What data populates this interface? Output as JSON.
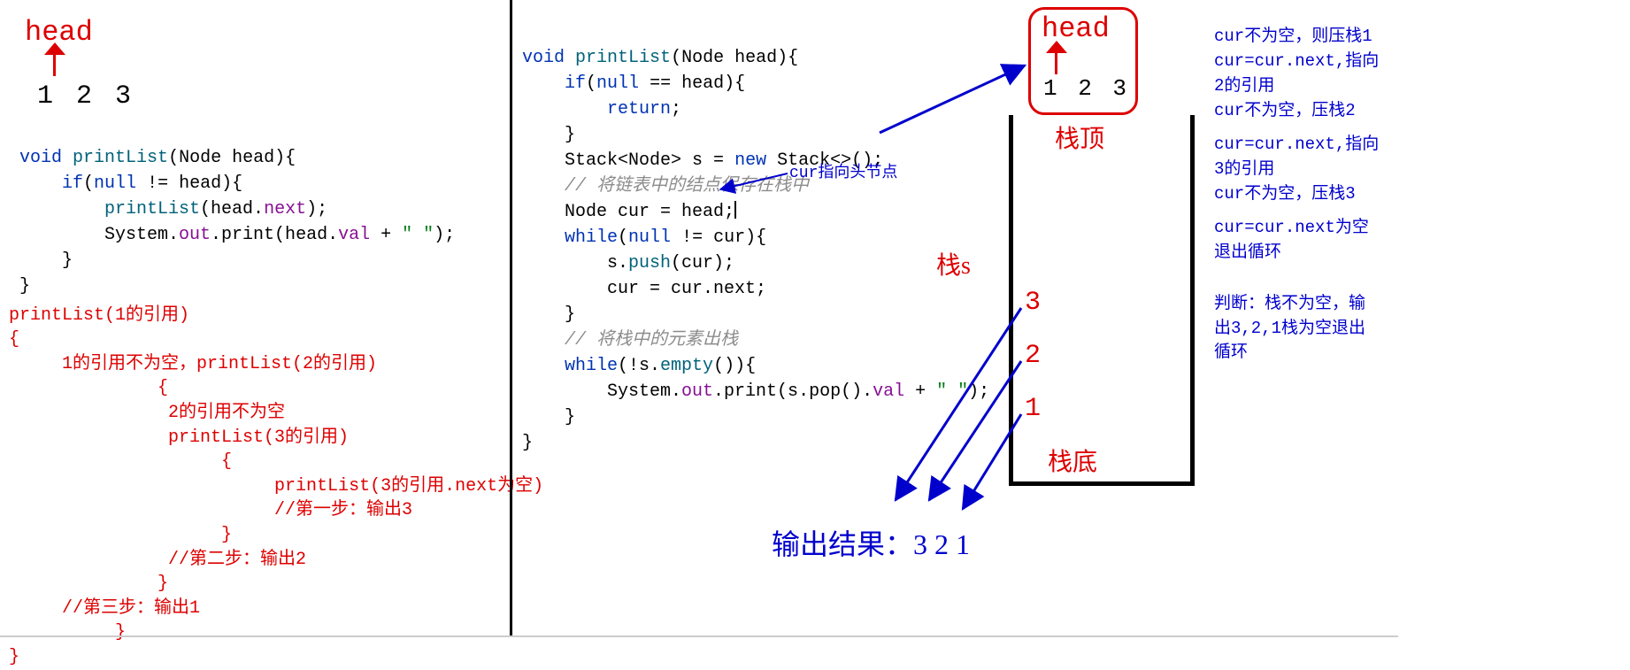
{
  "left": {
    "head_label": "head",
    "nums": "1 2 3",
    "code": {
      "l1_void": "void",
      "l1_method": "printList",
      "l1_sig_open": "(",
      "l1_ntype": "Node",
      "l1_param": " head){",
      "l2_if": "if",
      "l2_cond_open": "(",
      "l2_null": "null",
      "l2_rest": " != head){",
      "l3_call": "printList",
      "l3_open": "(head.",
      "l3_next": "next",
      "l3_close": ");",
      "l4_sys": "System.",
      "l4_out": "out",
      "l4_print": ".print(head.",
      "l4_val": "val",
      "l4_plus": " + ",
      "l4_str": "\" \"",
      "l4_end": ");",
      "l5": "    }",
      "l6": "}"
    },
    "trace": {
      "t0": "printList(1的引用)",
      "t0b": "{",
      "t1": "     1的引用不为空，printList(2的引用)",
      "t1b": "              {",
      "t2": "               2的引用不为空",
      "t3": "               printList(3的引用)",
      "t3b": "                    {",
      "t4": "                         printList(3的引用.next为空)",
      "t5": "                         //第一步：输出3",
      "t5b": "                    }",
      "t6": "               //第二步：输出2",
      "t6b": "              }",
      "t7": "     //第三步：输出1",
      "t7b": "          }",
      "t8": "}"
    }
  },
  "right": {
    "code": {
      "l1_void": "void",
      "l1_method": "printList",
      "l1_open": "(",
      "l1_ntype": "Node",
      "l1_rest": " head){",
      "l2_if": "if",
      "l2_open": "(",
      "l2_null": "null",
      "l2_rest": " == head){",
      "l3_return": "return",
      "l3_semi": ";",
      "l4": "    }",
      "l5_stack1": "    Stack<",
      "l5_ntype": "Node",
      "l5_close": "> s = ",
      "l5_new": "new",
      "l5_stk": " Stack<>();",
      "l6_cmt": "// 将链表中的结点保存在栈中",
      "l7_ntype": "Node",
      "l7_rest": " cur = head;",
      "l8_while": "while",
      "l8_open": "(",
      "l8_null": "null",
      "l8_rest": " != cur){",
      "l9_s": "        s.",
      "l9_push": "push",
      "l9_arg": "(cur);",
      "l10": "        cur = cur.next;",
      "l11": "    }",
      "l12_cmt": "// 将栈中的元素出栈",
      "l13_while": "while",
      "l13_open": "(!s.",
      "l13_empty": "empty",
      "l13_close": "()){",
      "l14_sys": "        System.",
      "l14_out": "out",
      "l14_print": ".print(s.pop().",
      "l14_val": "val",
      "l14_plus": " + ",
      "l14_str": "\" \"",
      "l14_end": ");",
      "l15": "    }",
      "l16": "}"
    },
    "cur_note": "cur指向头节点",
    "head_label": "head",
    "nums": "1 2 3",
    "stack_top": "栈顶",
    "stack_name": "栈s",
    "stack_bottom": "栈底",
    "stack_items": {
      "a": "3",
      "b": "2",
      "c": "1"
    },
    "output": "输出结果：3 2 1",
    "notes": {
      "n1": "cur不为空，则压栈1",
      "n2": "cur=cur.next,指向\n2的引用",
      "n3": "cur不为空，压栈2",
      "n4": "cur=cur.next,指向\n3的引用",
      "n5": "cur不为空，压栈3",
      "n6": "cur=cur.next为空\n退出循环",
      "n7": "判断：栈不为空，输\n出3,2,1栈为空退出\n循环"
    }
  }
}
